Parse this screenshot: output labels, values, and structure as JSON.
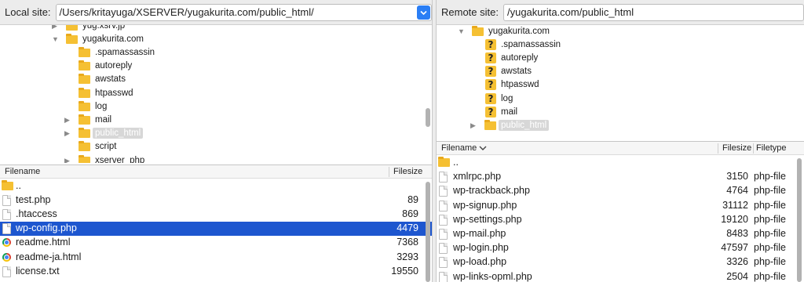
{
  "local": {
    "site_label": "Local site:",
    "path": "/Users/kritayuga/XSERVER/yugakurita.com/public_html/",
    "tree": [
      {
        "label": "yug.xsrv.jp",
        "arrow": "right",
        "icon": "folder",
        "level": 1,
        "selected": false
      },
      {
        "label": "yugakurita.com",
        "arrow": "down",
        "icon": "folder",
        "level": 1,
        "selected": false
      },
      {
        "label": ".spamassassin",
        "arrow": "",
        "icon": "folder",
        "level": 2,
        "selected": false
      },
      {
        "label": "autoreply",
        "arrow": "",
        "icon": "folder",
        "level": 2,
        "selected": false
      },
      {
        "label": "awstats",
        "arrow": "",
        "icon": "folder",
        "level": 2,
        "selected": false
      },
      {
        "label": "htpasswd",
        "arrow": "",
        "icon": "folder",
        "level": 2,
        "selected": false
      },
      {
        "label": "log",
        "arrow": "",
        "icon": "folder",
        "level": 2,
        "selected": false
      },
      {
        "label": "mail",
        "arrow": "right",
        "icon": "folder",
        "level": 2,
        "selected": false
      },
      {
        "label": "public_html",
        "arrow": "right",
        "icon": "folder",
        "level": 2,
        "selected": true
      },
      {
        "label": "script",
        "arrow": "",
        "icon": "folder",
        "level": 2,
        "selected": false
      },
      {
        "label": "xserver_php",
        "arrow": "right",
        "icon": "folder",
        "level": 2,
        "selected": false
      }
    ],
    "columns": {
      "filename": "Filename",
      "filesize": "Filesize"
    },
    "files": [
      {
        "name": "..",
        "size": "",
        "icon": "folder",
        "selected": false
      },
      {
        "name": "test.php",
        "size": "89",
        "icon": "doc",
        "selected": false
      },
      {
        "name": ".htaccess",
        "size": "869",
        "icon": "doc",
        "selected": false
      },
      {
        "name": "wp-config.php",
        "size": "4479",
        "icon": "doc",
        "selected": true
      },
      {
        "name": "readme.html",
        "size": "7368",
        "icon": "chrome",
        "selected": false
      },
      {
        "name": "readme-ja.html",
        "size": "3293",
        "icon": "chrome",
        "selected": false
      },
      {
        "name": "license.txt",
        "size": "19550",
        "icon": "doc",
        "selected": false
      }
    ]
  },
  "remote": {
    "site_label": "Remote site:",
    "path": "/yugakurita.com/public_html",
    "tree": [
      {
        "label": "yugakurita.com",
        "arrow": "down",
        "icon": "folder",
        "level": 1,
        "selected": false
      },
      {
        "label": ".spamassassin",
        "arrow": "",
        "icon": "qfolder",
        "level": 2,
        "selected": false
      },
      {
        "label": "autoreply",
        "arrow": "",
        "icon": "qfolder",
        "level": 2,
        "selected": false
      },
      {
        "label": "awstats",
        "arrow": "",
        "icon": "qfolder",
        "level": 2,
        "selected": false
      },
      {
        "label": "htpasswd",
        "arrow": "",
        "icon": "qfolder",
        "level": 2,
        "selected": false
      },
      {
        "label": "log",
        "arrow": "",
        "icon": "qfolder",
        "level": 2,
        "selected": false
      },
      {
        "label": "mail",
        "arrow": "",
        "icon": "qfolder",
        "level": 2,
        "selected": false
      },
      {
        "label": "public_html",
        "arrow": "right",
        "icon": "folder",
        "level": 2,
        "selected": true
      }
    ],
    "columns": {
      "filename": "Filename",
      "filesize": "Filesize",
      "filetype": "Filetype"
    },
    "files": [
      {
        "name": "..",
        "size": "",
        "type": "",
        "icon": "folder"
      },
      {
        "name": "xmlrpc.php",
        "size": "3150",
        "type": "php-file",
        "icon": "doc"
      },
      {
        "name": "wp-trackback.php",
        "size": "4764",
        "type": "php-file",
        "icon": "doc"
      },
      {
        "name": "wp-signup.php",
        "size": "31112",
        "type": "php-file",
        "icon": "doc"
      },
      {
        "name": "wp-settings.php",
        "size": "19120",
        "type": "php-file",
        "icon": "doc"
      },
      {
        "name": "wp-mail.php",
        "size": "8483",
        "type": "php-file",
        "icon": "doc"
      },
      {
        "name": "wp-login.php",
        "size": "47597",
        "type": "php-file",
        "icon": "doc"
      },
      {
        "name": "wp-load.php",
        "size": "3326",
        "type": "php-file",
        "icon": "doc"
      },
      {
        "name": "wp-links-opml.php",
        "size": "2504",
        "type": "php-file",
        "icon": "doc"
      }
    ]
  },
  "colors": {
    "selection": "#1d56cf",
    "folder": "#f5c033",
    "dropdown": "#2a7ef5"
  }
}
